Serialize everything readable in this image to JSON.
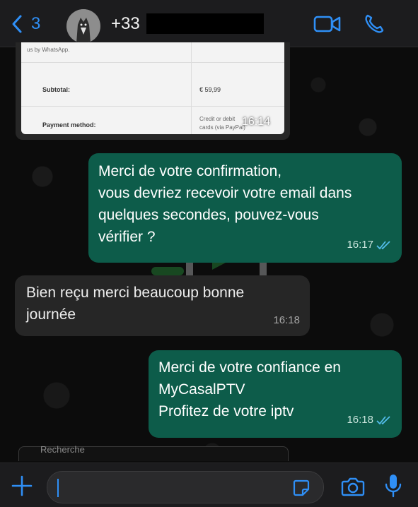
{
  "header": {
    "back_count": "3",
    "contact_name": "+33"
  },
  "image_message": {
    "receipt_fragment": "us by WhatsApp.",
    "subtotal_label": "Subtotal:",
    "subtotal_value": "€ 59,99",
    "payment_label": "Payment method:",
    "payment_value_1": "Credit or debit",
    "payment_value_2": "cards (via PayPal)",
    "time": "16:14"
  },
  "messages": [
    {
      "direction": "out",
      "lines": [
        "Merci de votre confirmation,",
        "vous devriez recevoir votre email dans",
        "quelques secondes, pouvez-vous",
        "vérifier ?"
      ],
      "time": "16:17",
      "status": "read"
    },
    {
      "direction": "in",
      "lines": [
        "Bien reçu merci beaucoup bonne",
        "journée"
      ],
      "time": "16:18"
    },
    {
      "direction": "out",
      "lines": [
        "Merci de votre confiance en",
        "MyCasalPTV",
        "Profitez de votre iptv"
      ],
      "time": "16:18",
      "status": "read"
    }
  ],
  "search_strip": {
    "label": "Recherche"
  },
  "composer": {
    "placeholder": ""
  },
  "colors": {
    "accent": "#2f8ff6",
    "outgoing_bubble": "#0d5c4a",
    "incoming_bubble": "#262626",
    "header": "#1c1c1e",
    "read_ticks": "#53bdeb"
  },
  "icons": [
    "chevron-left-icon",
    "video-camera-icon",
    "phone-icon",
    "double-check-icon",
    "plus-icon",
    "sticker-icon",
    "camera-icon",
    "microphone-icon"
  ]
}
